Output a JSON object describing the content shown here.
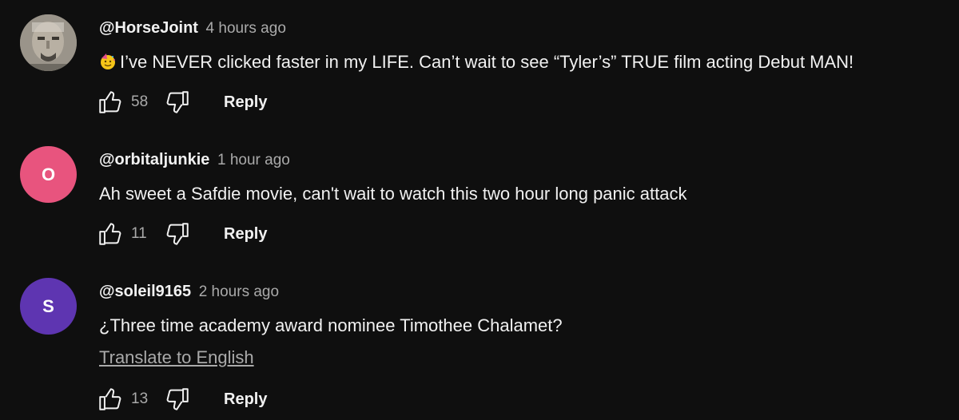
{
  "comments": [
    {
      "author": "@HorseJoint",
      "time": "4 hours ago",
      "text": "I’ve NEVER clicked faster in my LIFE. Can’t wait to see “Tyler’s” TRUE film acting Debut MAN!",
      "emoji_icon": "partying-face-emoji",
      "avatar_type": "photo",
      "likes": "58",
      "reply_label": "Reply"
    },
    {
      "author": "@orbitaljunkie",
      "time": "1 hour ago",
      "text": "Ah sweet a Safdie movie, can't wait to watch this two hour long panic attack",
      "avatar_letter": "O",
      "avatar_color": "#e8547e",
      "likes": "11",
      "reply_label": "Reply"
    },
    {
      "author": "@soleil9165",
      "time": "2 hours ago",
      "text": "¿Three time academy award nominee Timothee Chalamet?",
      "translate_label": "Translate to English",
      "avatar_letter": "S",
      "avatar_color": "#5e35b1",
      "likes": "13",
      "reply_label": "Reply"
    }
  ],
  "colors": {
    "background": "#0f0f0f",
    "primary_text": "#f1f1f1",
    "secondary_text": "#aaaaaa"
  }
}
